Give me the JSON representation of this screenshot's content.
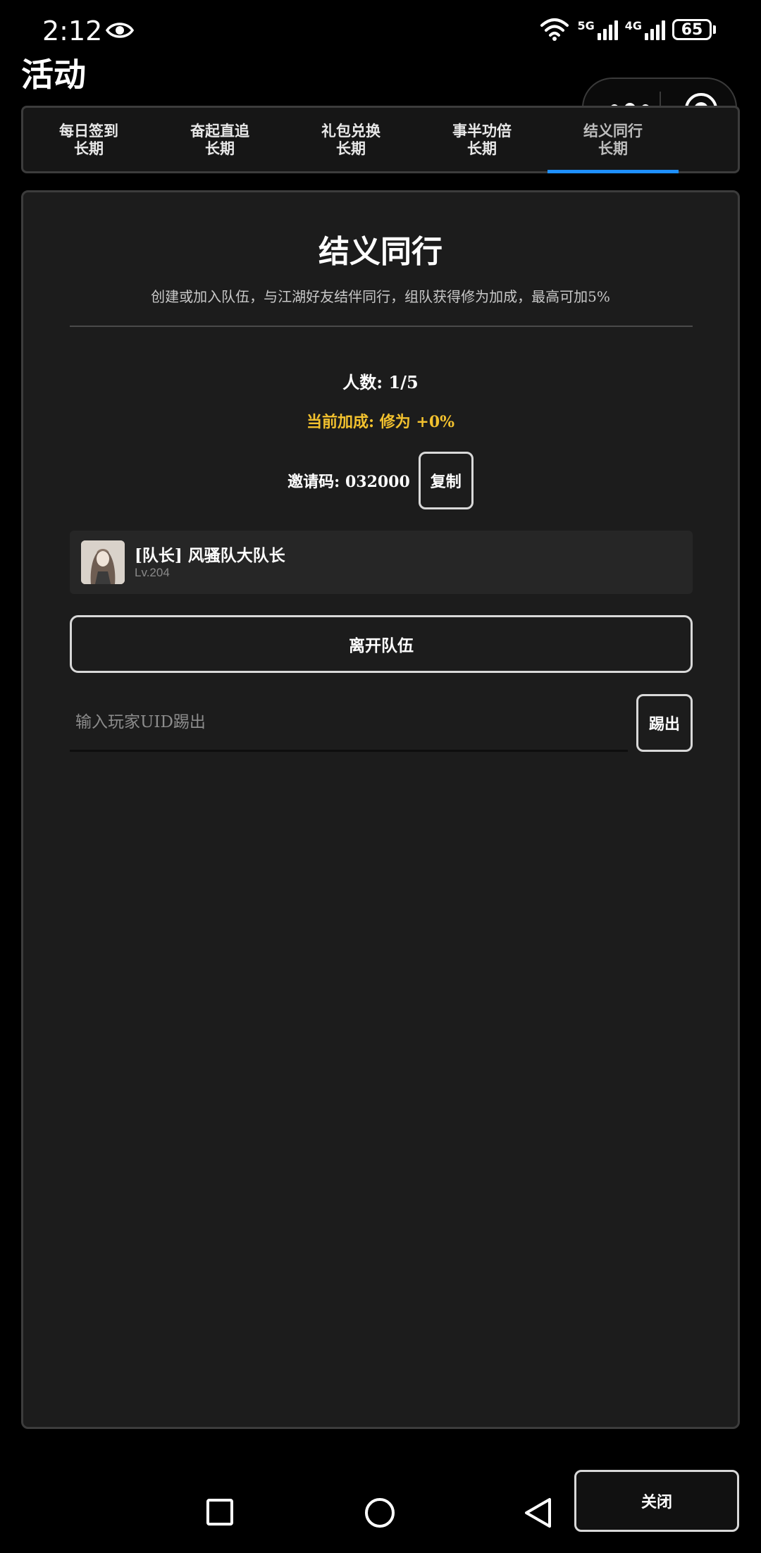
{
  "status_bar": {
    "time": "2:12",
    "network1_label": "5G",
    "network2_label": "4G",
    "battery": "65",
    "icons": [
      "eye-icon",
      "wifi-icon",
      "signal-icon",
      "battery-icon"
    ]
  },
  "header": {
    "title": "活动"
  },
  "capsule": {
    "icons": [
      "more-dots-icon",
      "close-target-icon"
    ]
  },
  "tabs": [
    {
      "line1": "每日签到",
      "line2": "长期"
    },
    {
      "line1": "奋起直追",
      "line2": "长期"
    },
    {
      "line1": "礼包兑换",
      "line2": "长期"
    },
    {
      "line1": "事半功倍",
      "line2": "长期"
    },
    {
      "line1": "结义同行",
      "line2": "长期"
    }
  ],
  "active_tab_index": 4,
  "panel": {
    "title": "结义同行",
    "description": "创建或加入队伍，与江湖好友结伴同行，组队获得修为加成，最高可加5%",
    "members_count": "人数: 1/5",
    "bonus": "当前加成: 修为 +0%",
    "invite_code": "邀请码: 032000",
    "copy_label": "复制",
    "member": {
      "name": "[队长] 风骚队大队长",
      "level": "Lv.204"
    },
    "leave_label": "离开队伍",
    "kick_placeholder": "输入玩家UID踢出",
    "kick_label": "踢出"
  },
  "footer": {
    "close_label": "关闭"
  },
  "colors": {
    "accent": "#1e8fff",
    "bonus": "#f2c12e",
    "panel_bg": "#1c1c1c",
    "page_bg": "#000000"
  }
}
